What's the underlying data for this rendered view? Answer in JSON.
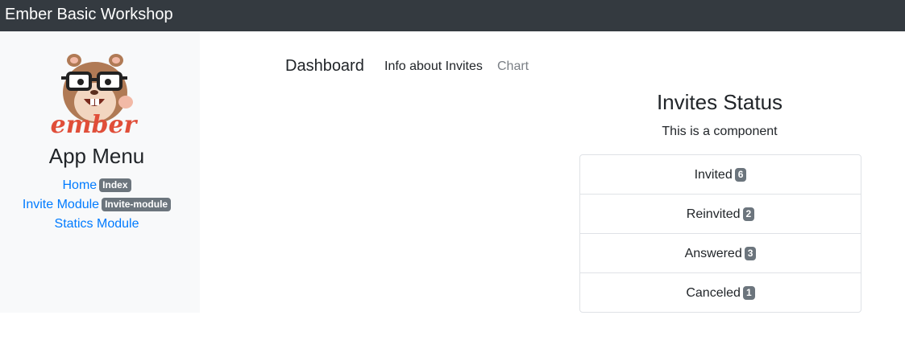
{
  "header": {
    "brand": "Ember Basic Workshop"
  },
  "sidebar": {
    "logo_icon": "ember-hamster-logo",
    "logo_text": "ember",
    "title": "App Menu",
    "items": [
      {
        "label": "Home",
        "badge": "Index"
      },
      {
        "label": "Invite Module",
        "badge": "Invite-module"
      },
      {
        "label": "Statics Module",
        "badge": ""
      }
    ]
  },
  "nav": {
    "brand": "Dashboard",
    "links": [
      "Info about Invites",
      "Chart"
    ]
  },
  "status": {
    "title": "Invites Status",
    "subtitle": "This is a component",
    "rows": [
      {
        "label": "Invited",
        "count": "6"
      },
      {
        "label": "Reinvited",
        "count": "2"
      },
      {
        "label": "Answered",
        "count": "3"
      },
      {
        "label": "Canceled",
        "count": "1"
      }
    ]
  },
  "colors": {
    "topbar": "#343a40",
    "sidebar": "#f8f9fa",
    "link": "#007bff",
    "badge": "#6c757d",
    "logo_red": "#e04e39"
  }
}
